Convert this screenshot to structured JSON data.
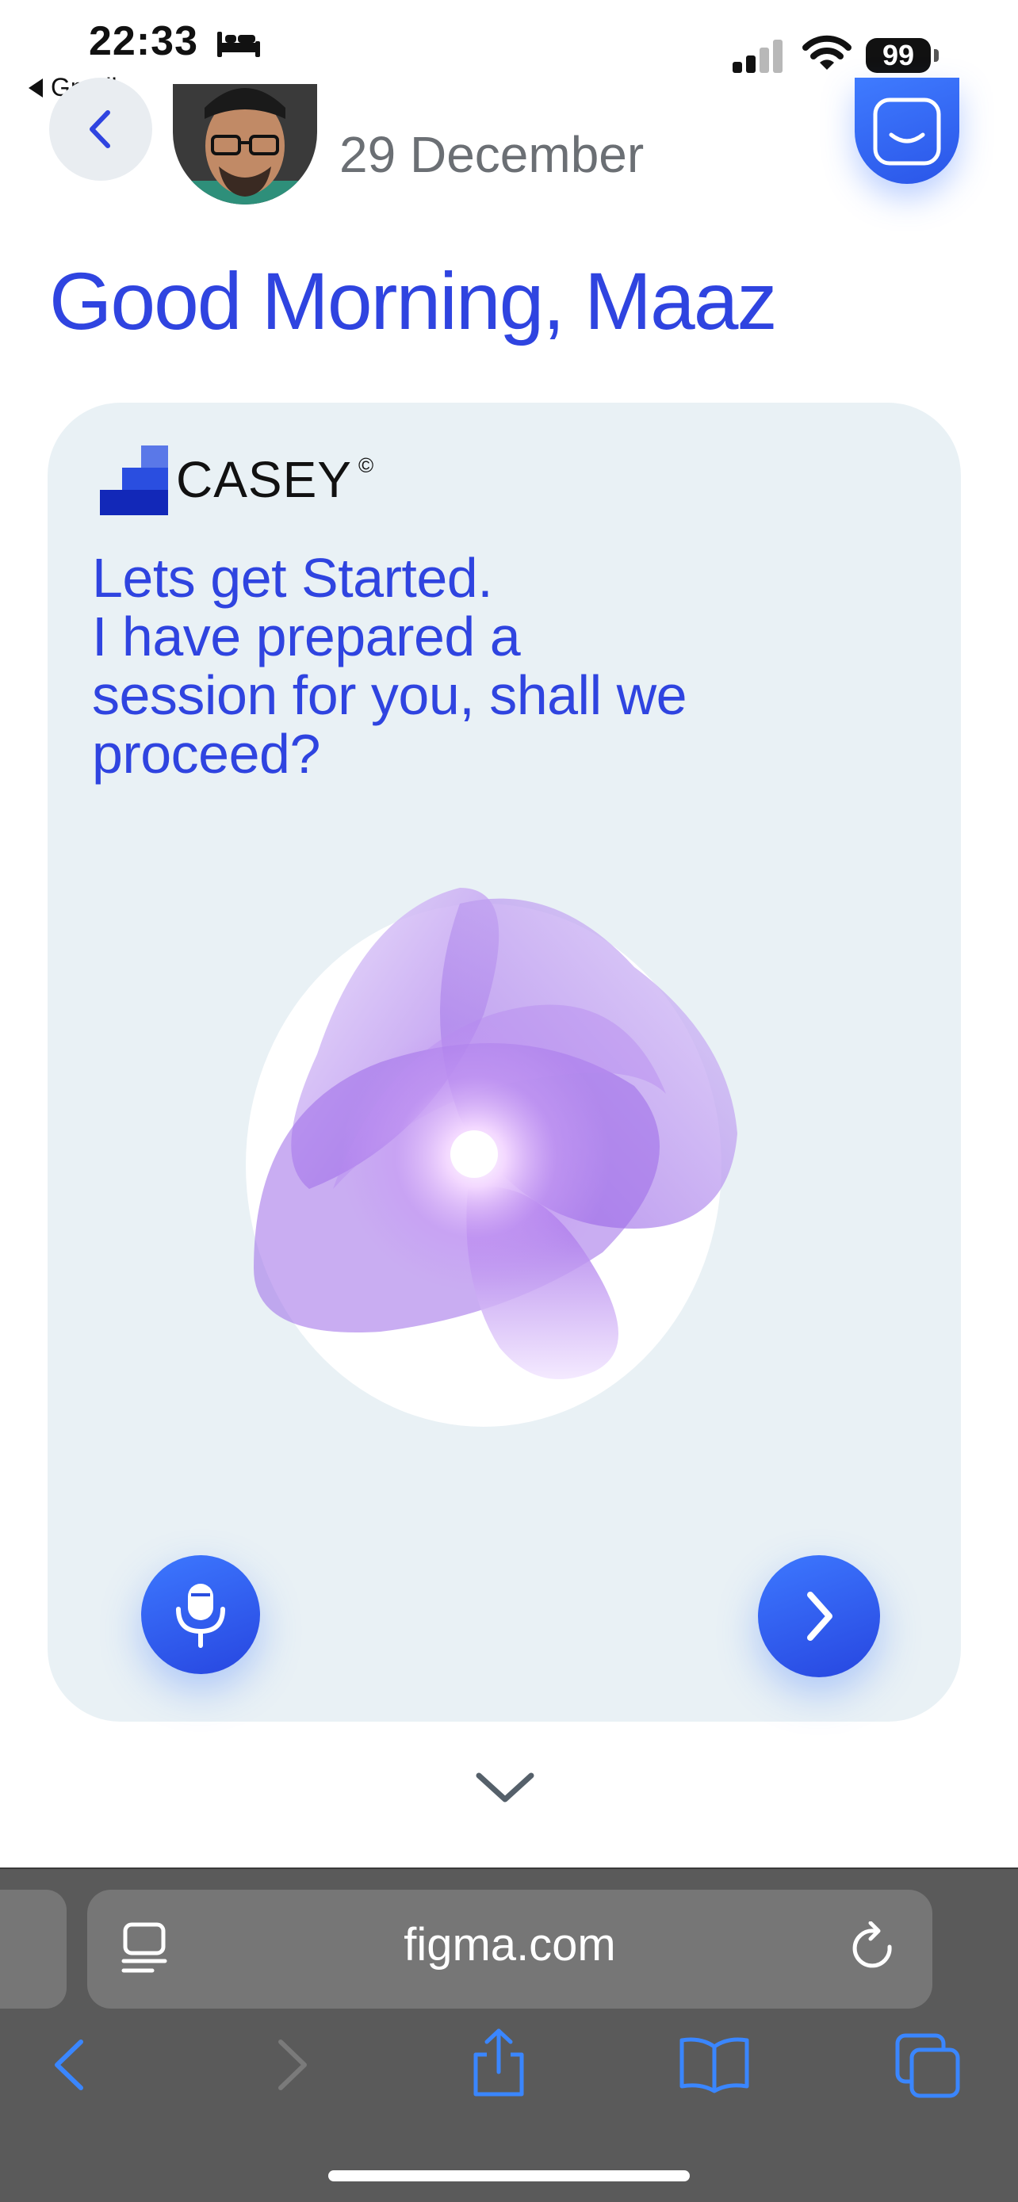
{
  "status_bar": {
    "time": "22:33",
    "back_app_label": "Gmail",
    "battery": "99",
    "icons": [
      "bed-icon",
      "signal-icon",
      "wifi-icon",
      "battery-icon"
    ]
  },
  "header": {
    "date": "29 December",
    "icons": [
      "chevron-left-icon",
      "avatar",
      "smiley-icon"
    ]
  },
  "greeting": "Good Morning, Maaz",
  "card": {
    "brand_name": "CASEY",
    "brand_mark": "©",
    "message_lines": [
      "Lets get Started.",
      "I have prepared a",
      "session for you, shall we",
      "proceed?"
    ],
    "icons": [
      "casey-logo-icon",
      "orb-visual",
      "microphone-icon",
      "chevron-right-icon",
      "chevron-down-icon"
    ]
  },
  "browser": {
    "url": "figma.com",
    "icons": [
      "reader-icon",
      "reload-icon",
      "back-icon",
      "forward-icon",
      "share-icon",
      "bookmarks-icon",
      "tabs-icon"
    ]
  },
  "colors": {
    "accent_blue": "#2f44e0",
    "button_blue": "#2a55e8",
    "card_bg": "#e9f1f5",
    "date_gray": "#6b6f74",
    "browser_bar": "#5a5a5a",
    "browser_accent": "#3a86ff"
  }
}
